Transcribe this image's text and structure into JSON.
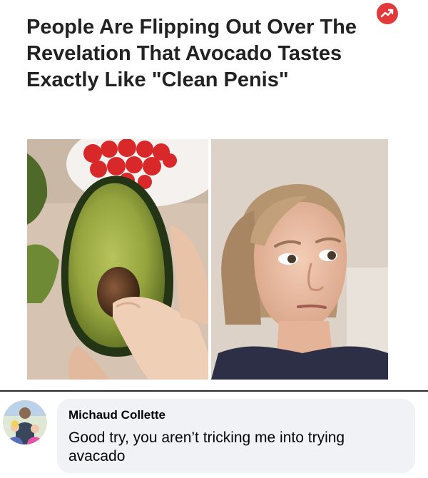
{
  "article": {
    "headline": "People Are Flipping Out Over The Revelation That Avocado Tastes Exactly Like \"Clean Penis\"",
    "badge_icon": "trending-arrow-icon",
    "badge_color": "#e23a3a",
    "photos": [
      {
        "name": "avocado-half-photo",
        "icon": "avocado-photo"
      },
      {
        "name": "woman-reaction-photo",
        "icon": "side-eye-woman-photo"
      }
    ]
  },
  "comment": {
    "avatar_icon": "profile-avatar",
    "author": "Michaud Collette",
    "text": "Good try, you aren’t tricking me into trying avacado",
    "bubble_color": "#f0f2f5"
  }
}
